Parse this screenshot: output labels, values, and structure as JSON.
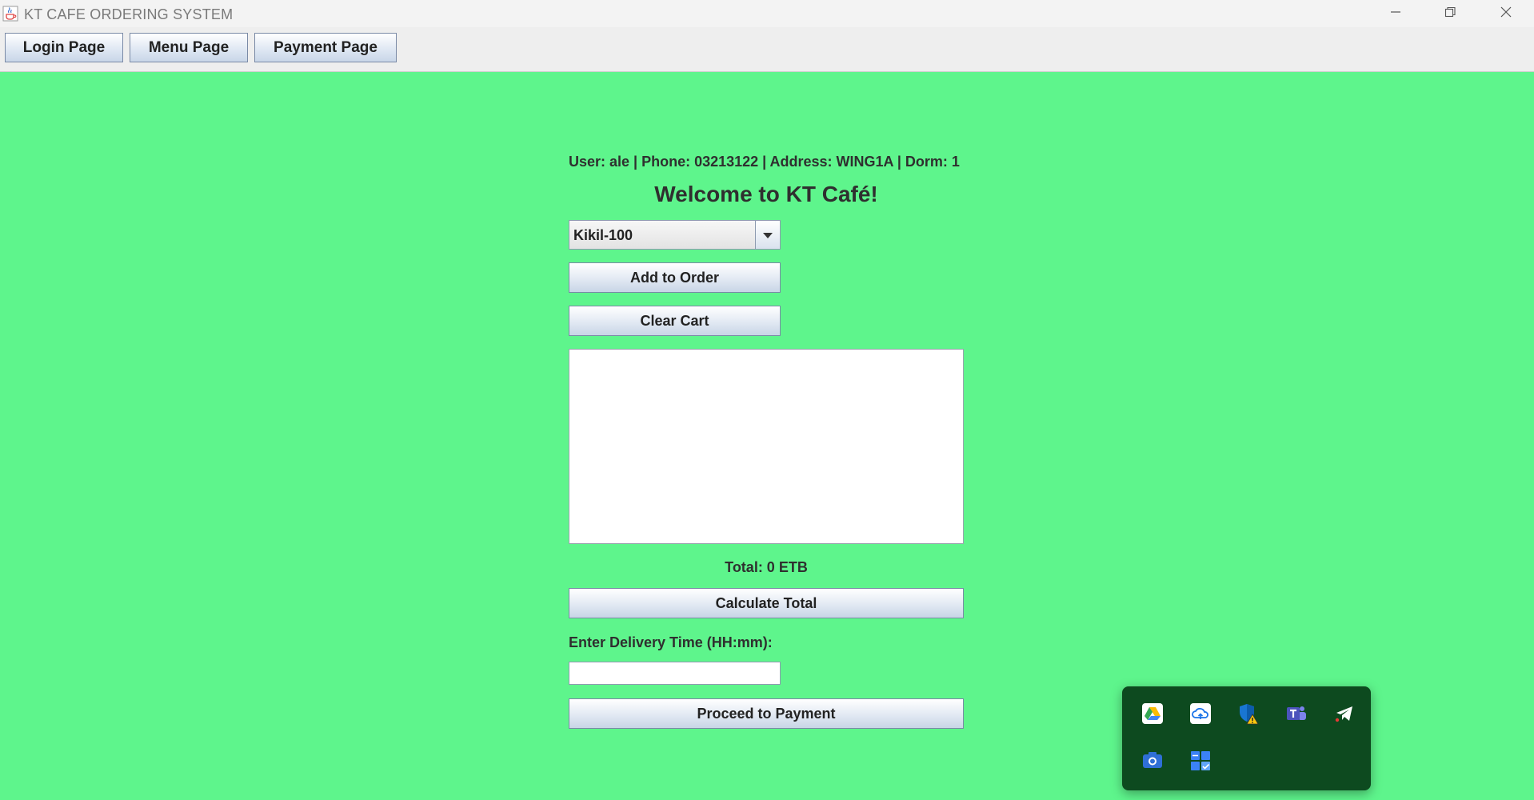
{
  "window": {
    "title": "KT CAFE ORDERING SYSTEM",
    "background_color": "#5ef58c",
    "icon": "java-cup-icon",
    "controls": [
      "minimize-icon",
      "restore-icon",
      "close-icon"
    ]
  },
  "navbar": {
    "login_label": "Login Page",
    "menu_label": "Menu Page",
    "payment_label": "Payment Page"
  },
  "main": {
    "user_info": "User: ale | Phone: 03213122 | Address: WING1A | Dorm: 1",
    "welcome": "Welcome to KT Café!",
    "menu_select": {
      "selected": "Kikil-100"
    },
    "add_to_order_label": "Add to Order",
    "clear_cart_label": "Clear Cart",
    "order_summary_text": "",
    "total_label": "Total: 0 ETB",
    "calculate_total_label": "Calculate Total",
    "delivery_time_label": "Enter Delivery Time (HH:mm):",
    "delivery_time_value": "",
    "proceed_label": "Proceed to Payment"
  },
  "tray": {
    "background_color": "#0d4a1f",
    "icons": [
      "google-drive-icon",
      "onedrive-cloud-icon",
      "windows-security-warning-icon",
      "teams-icon",
      "telegram-icon",
      "camera-app-icon",
      "widget-app-icon"
    ]
  }
}
